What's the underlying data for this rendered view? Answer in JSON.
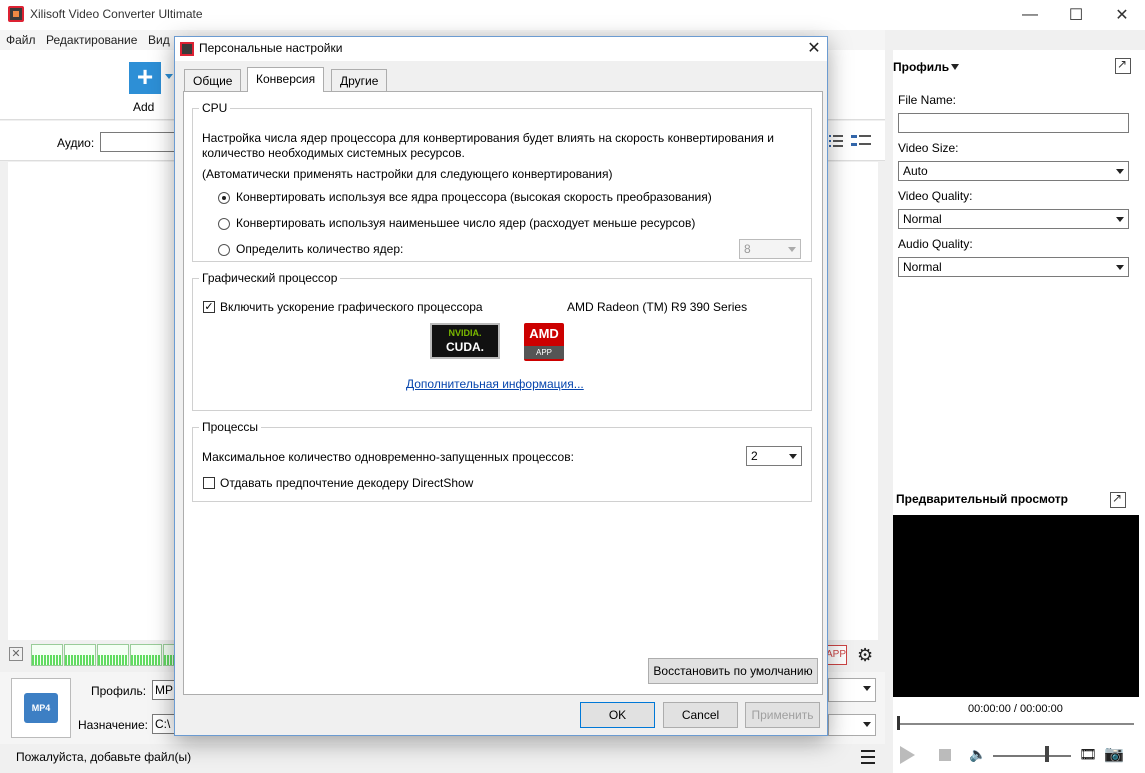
{
  "window": {
    "title": "Xilisoft Video Converter Ultimate",
    "min": "—",
    "max": "☐",
    "close": "✕"
  },
  "menu": {
    "items": [
      "Файл",
      "Редактирование",
      "Вид"
    ]
  },
  "toolbar": {
    "add_label": "Add"
  },
  "audio": {
    "label": "Аудио:"
  },
  "profile_area": {
    "profile_label": "Профиль:",
    "profile_value": "MP",
    "destination_label": "Назначение:",
    "destination_value": "C:\\",
    "app_badge": "APP"
  },
  "status": {
    "text": "Пожалуйста, добавьте файл(ы)"
  },
  "right_panel": {
    "profile_heading": "Профиль",
    "file_name_label": "File Name:",
    "file_name_value": "",
    "video_size_label": "Video Size:",
    "video_size_value": "Auto",
    "video_quality_label": "Video Quality:",
    "video_quality_value": "Normal",
    "audio_quality_label": "Audio Quality:",
    "audio_quality_value": "Normal",
    "preview_heading": "Предварительный просмотр",
    "time": "00:00:00 / 00:00:00"
  },
  "dialog": {
    "title": "Персональные настройки",
    "close": "✕",
    "tabs": [
      "Общие",
      "Конверсия",
      "Другие"
    ],
    "active_tab": "Конверсия",
    "cpu": {
      "legend": "CPU",
      "desc_line1": "Настройка числа ядер процессора для конвертирования будет влиять на скорость конвертирования и",
      "desc_line2": "количество необходимых системных ресурсов.",
      "auto_note": "(Автоматически применять настройки для следующего конвертирования)",
      "option_all": "Конвертировать используя все ядра процессора (высокая скорость преобразования)",
      "option_min": "Конвертировать используя наименьшее число ядер (расходует меньше ресурсов)",
      "option_custom": "Определить количество ядер:",
      "core_count": "8",
      "selected_option": "option_all"
    },
    "gpu": {
      "legend": "Графический процессор",
      "enable_label": "Включить ускорение графического процессора",
      "enabled": true,
      "gpu_name": "AMD Radeon (TM) R9 390 Series",
      "nvidia_top": "NVIDIA.",
      "nvidia_bottom": "CUDA.",
      "amd_top": "AMD",
      "amd_bottom": "APP",
      "more_info": "Дополнительная информация..."
    },
    "processes": {
      "legend": "Процессы",
      "max_label": "Максимальное количество одновременно-запущенных процессов:",
      "max_value": "2",
      "directshow_label": "Отдавать предпочтение декодеру DirectShow",
      "directshow": false
    },
    "restore_defaults": "Восстановить по умолчанию",
    "ok": "OK",
    "cancel": "Cancel",
    "apply": "Применить"
  },
  "colors": {
    "accent": "#2d8fd6",
    "link": "#0645ad",
    "dialog_border": "#6b9bd1"
  }
}
